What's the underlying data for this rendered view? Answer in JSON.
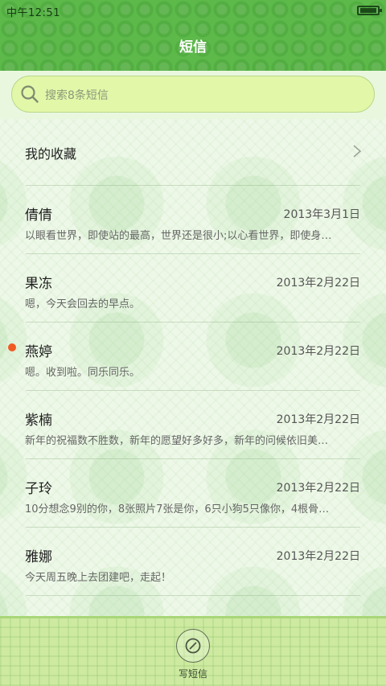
{
  "status_bar": {
    "time": "中午12:51"
  },
  "header": {
    "title": "短信"
  },
  "search": {
    "placeholder": "搜索8条短信"
  },
  "favorites": {
    "label": "我的收藏"
  },
  "messages": [
    {
      "name": "倩倩",
      "date": "2013年3月1日",
      "preview": "以眼看世界，即使站的最高，世界还是很小;以心看世界，即使身…",
      "unread": false
    },
    {
      "name": "果冻",
      "date": "2013年2月22日",
      "preview": "嗯，今天会回去的早点。",
      "unread": false
    },
    {
      "name": "燕婷",
      "date": "2013年2月22日",
      "preview": "嗯。收到啦。同乐同乐。",
      "unread": true
    },
    {
      "name": "紫楠",
      "date": "2013年2月22日",
      "preview": "新年的祝福数不胜数，新年的愿望好多好多，新年的问候依旧美…",
      "unread": false
    },
    {
      "name": "子玲",
      "date": "2013年2月22日",
      "preview": "10分想念9别的你，8张照片7张是你，6只小狗5只像你，4根骨…",
      "unread": false
    },
    {
      "name": "雅娜",
      "date": "2013年2月22日",
      "preview": "今天周五晚上去团建吧，走起！",
      "unread": false
    }
  ],
  "bottom": {
    "compose_label": "写短信"
  },
  "colors": {
    "header": "#5cb94a",
    "search_bg": "#e3f7a9",
    "unread": "#f15a22"
  }
}
